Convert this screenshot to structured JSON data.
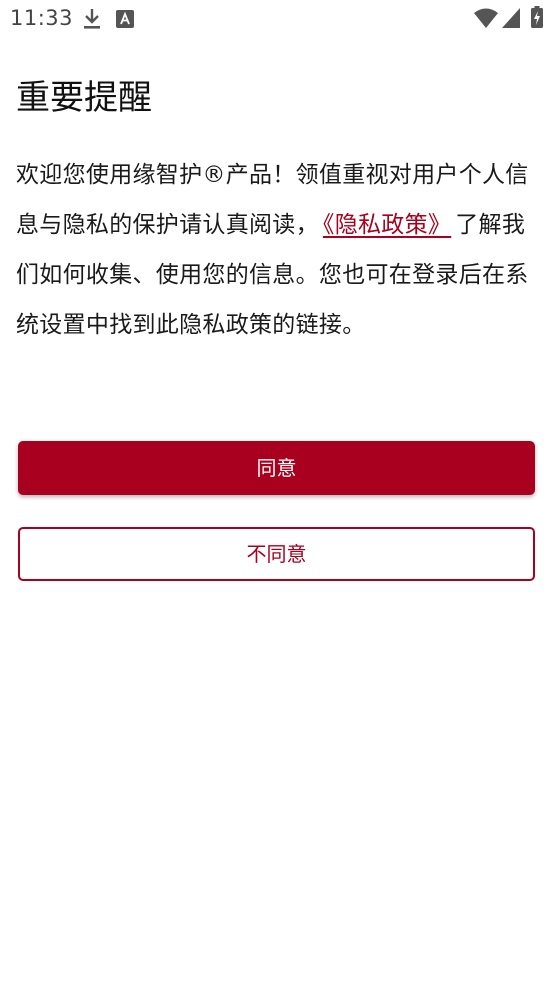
{
  "status_bar": {
    "time": "11:33",
    "icons": [
      "download-icon",
      "font-a-icon",
      "wifi-icon",
      "signal-icon",
      "battery-charging-icon"
    ]
  },
  "dialog": {
    "title": "重要提醒",
    "body_before": "欢迎您使用缘智护®产品！领值重视对用户个人信息与隐私的保护请认真阅读，",
    "privacy_link": "《隐私政策》",
    "body_after": "了解我们如何收集、使用您的信息。您也可在登录后在系统设置中找到此隐私政策的链接。",
    "agree_label": "同意",
    "disagree_label": "不同意"
  },
  "colors": {
    "accent": "#a8001e",
    "text": "#1a1a1a",
    "status_icon": "#555555"
  }
}
